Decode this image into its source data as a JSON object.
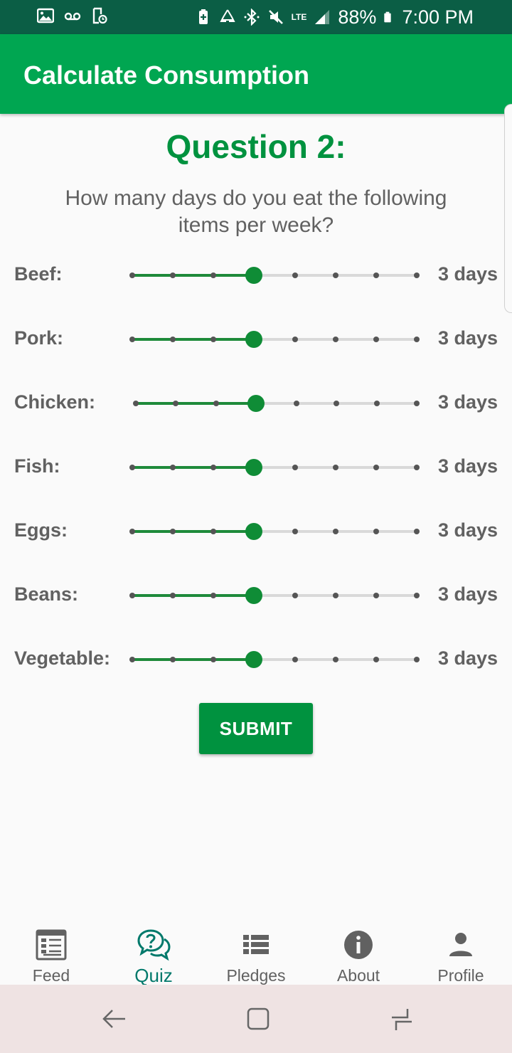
{
  "status_bar": {
    "battery": "88%",
    "time": "7:00 PM",
    "network": "LTE",
    "left_icons": [
      "image-icon",
      "voicemail-icon",
      "screenshot-icon"
    ],
    "right_icons": [
      "battery-saver-icon",
      "recycle-icon",
      "bluetooth-icon",
      "mute-icon",
      "lte-icon",
      "signal-icon",
      "battery-icon"
    ]
  },
  "app_bar": {
    "title": "Calculate Consumption"
  },
  "question": {
    "title": "Question 2:",
    "text": "How many days do you eat the following items per week?"
  },
  "items": [
    {
      "label": "Beef:",
      "value_text": "3 days",
      "value": 3
    },
    {
      "label": "Pork:",
      "value_text": "3 days",
      "value": 3
    },
    {
      "label": "Chicken:",
      "value_text": "3 days",
      "value": 3
    },
    {
      "label": "Fish:",
      "value_text": "3 days",
      "value": 3
    },
    {
      "label": "Eggs:",
      "value_text": "3 days",
      "value": 3
    },
    {
      "label": "Beans:",
      "value_text": "3 days",
      "value": 3
    },
    {
      "label": "Vegetable:",
      "value_text": "3 days",
      "value": 3
    }
  ],
  "slider_range": {
    "min": 0,
    "max": 7
  },
  "submit_label": "SUBMIT",
  "bottom_nav": {
    "active": "Quiz",
    "items": [
      {
        "label": "Feed",
        "icon": "feed-icon"
      },
      {
        "label": "Quiz",
        "icon": "quiz-icon"
      },
      {
        "label": "Pledges",
        "icon": "list-icon"
      },
      {
        "label": "About",
        "icon": "info-icon"
      },
      {
        "label": "Profile",
        "icon": "person-icon"
      }
    ]
  },
  "system_nav": {
    "buttons": [
      "back-icon",
      "overview-icon",
      "recents-icon"
    ]
  },
  "colors": {
    "status_bar": "#0b5e45",
    "app_bar": "#00a651",
    "accent": "#00923f",
    "active_tab": "#00796b",
    "text_gray": "#616161"
  }
}
